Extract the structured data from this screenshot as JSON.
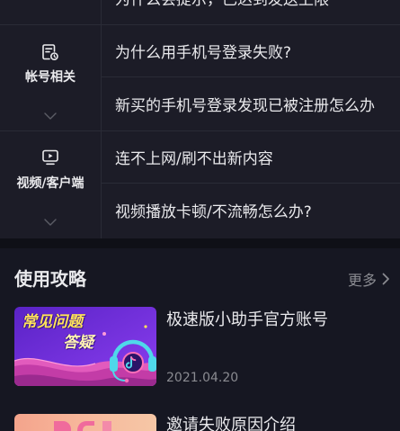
{
  "faq": {
    "top_partial_question": "为什么会提示，已达到发送上限",
    "categories": [
      {
        "label": "帐号相关",
        "icon": "account-doc-icon",
        "questions": [
          "为什么用手机号登录失败?",
          "新买的手机号登录发现已被注册怎么办"
        ]
      },
      {
        "label": "视频/客户端",
        "icon": "video-play-icon",
        "questions": [
          "连不上网/刷不出新内容",
          "视频播放卡顿/不流畅怎么办?"
        ]
      }
    ]
  },
  "guides": {
    "title": "使用攻略",
    "more_label": "更多",
    "more_icon": "chevron-right-icon",
    "items": [
      {
        "title": "极速版小助手官方账号",
        "date": "2021.04.20",
        "thumb_text": {
          "line1": "常见问题",
          "line2": "答疑"
        },
        "thumb_icon": "headphones-icon"
      },
      {
        "title": "邀请失败原因介绍"
      }
    ]
  },
  "colors": {
    "page_bg": "#161722",
    "faq_bg": "#1c1c27",
    "band_bg": "#0f1017",
    "divider": "#2a2b36",
    "text_primary": "#e9e9ec",
    "text_secondary": "#8a8b91",
    "chevron": "#5c5d66"
  }
}
